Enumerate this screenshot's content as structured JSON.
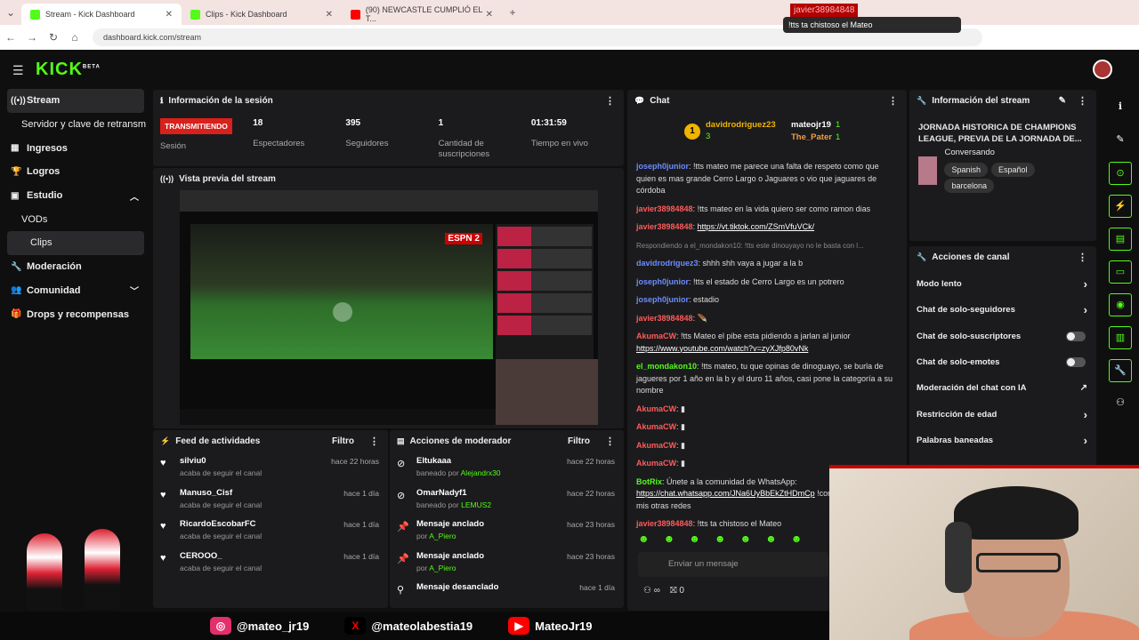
{
  "browser": {
    "tabs": [
      {
        "label": "Stream - Kick Dashboard",
        "active": true
      },
      {
        "label": "Clips - Kick Dashboard"
      },
      {
        "label": "(90) NEWCASTLE CUMPLIÓ EL T..."
      }
    ],
    "url": "dashboard.kick.com/stream"
  },
  "tooltip": {
    "user": "javier38984848",
    "text": "!tts ta chistoso el Mateo"
  },
  "header": {
    "logo": "KICK",
    "logo_sup": "BETA"
  },
  "sidebar": {
    "items": [
      {
        "label": "Stream"
      },
      {
        "label": "Servidor y clave de retransm"
      },
      {
        "label": "Ingresos"
      },
      {
        "label": "Logros"
      },
      {
        "label": "Estudio"
      },
      {
        "label": "VODs"
      },
      {
        "label": "Clips"
      },
      {
        "label": "Moderación"
      },
      {
        "label": "Comunidad"
      },
      {
        "label": "Drops y recompensas"
      }
    ]
  },
  "session": {
    "title": "Información de la sesión",
    "badge": "TRANSMITIENDO",
    "badge_label": "Sesión",
    "stats": [
      {
        "value": "18",
        "label": "Espectadores"
      },
      {
        "value": "395",
        "label": "Seguidores"
      },
      {
        "value": "1",
        "label": "Cantidad de suscripciones"
      },
      {
        "value": "01:31:59",
        "label": "Tiempo en vivo"
      }
    ]
  },
  "preview": {
    "title": "Vista previa del stream",
    "score": "ESPN 2"
  },
  "feed": {
    "title": "Feed de actividades",
    "filter": "Filtro",
    "items": [
      {
        "name": "silviu0",
        "sub": "acaba de seguir el canal",
        "time": "hace 22 horas"
      },
      {
        "name": "Manuso_Cisf",
        "sub": "acaba de seguir el canal",
        "time": "hace 1 día"
      },
      {
        "name": "RicardoEscobarFC",
        "sub": "acaba de seguir el canal",
        "time": "hace 1 día"
      },
      {
        "name": "CEROOO_",
        "sub": "acaba de seguir el canal",
        "time": "hace 1 día"
      }
    ]
  },
  "modactions": {
    "title": "Acciones de moderador",
    "filter": "Filtro",
    "items": [
      {
        "name": "Eltukaaa",
        "pre": "baneado por ",
        "by": "Alejandrx30",
        "time": "hace 22 horas"
      },
      {
        "name": "OmarNadyf1",
        "pre": "baneado por ",
        "by": "LEMUS2",
        "time": "hace 22 horas"
      },
      {
        "name": "Mensaje anclado",
        "pre": "por ",
        "by": "A_Piero",
        "time": "hace 23 horas"
      },
      {
        "name": "Mensaje anclado",
        "pre": "por ",
        "by": "A_Piero",
        "time": "hace 23 horas"
      },
      {
        "name": "Mensaje desanclado",
        "pre": "",
        "by": "",
        "time": "hace 1 día"
      }
    ]
  },
  "chat": {
    "title": "Chat",
    "top": [
      {
        "name": "davidrodriguez23",
        "count": "3"
      },
      {
        "name": "mateojr19",
        "count": "1"
      },
      {
        "name": "The_Pater",
        "count": "1"
      }
    ],
    "messages": [
      {
        "user": "joseph0junior",
        "cls": "u1",
        "text": ": !tts mateo me parece una falta de respeto como que quien es mas grande Cerro Largo o Jaguares o vio que jaguares de córdoba"
      },
      {
        "user": "javier38984848",
        "cls": "u2",
        "text": ": !tts mateo en la vida quiero ser como ramon dias"
      },
      {
        "user": "javier38984848",
        "cls": "u2",
        "text": ": ",
        "link": "https://vt.tiktok.com/ZSmVfuVCk/"
      },
      {
        "reply": "Respondiendo a el_mondakon10: !tts este dinouyayo no le basta con l..."
      },
      {
        "user": "davidrodriguez3",
        "cls": "u1",
        "text": ": shhh shh vaya a jugar a la b"
      },
      {
        "user": "joseph0junior",
        "cls": "u1",
        "text": ": !tts el estado de Cerro Largo es un potrero"
      },
      {
        "user": "joseph0junior",
        "cls": "u1",
        "text": ": estadio"
      },
      {
        "user": "javier38984848",
        "cls": "u2",
        "text": ": 🪶"
      },
      {
        "user": "AkumaCW",
        "cls": "u2",
        "text": ": !tts Mateo el pibe esta pidiendo a jarlan al junior ",
        "link": "https://www.youtube.com/watch?v=zyXJfp80vNk"
      },
      {
        "user": "el_mondakon10",
        "cls": "u3",
        "text": ": !tts mateo, tu que opinas de dinoguayo, se burla de jagueres por 1 año en la b y el duro 11 años, casi pone la categoría a su nombre"
      },
      {
        "user": "AkumaCW",
        "cls": "u2",
        "text": ": ▮"
      },
      {
        "user": "AkumaCW",
        "cls": "u2",
        "text": ": ▮"
      },
      {
        "user": "AkumaCW",
        "cls": "u2",
        "text": ": ▮"
      },
      {
        "user": "AkumaCW",
        "cls": "u2",
        "text": ": ▮"
      },
      {
        "user": "BotRix",
        "cls": "u3",
        "text": ": Únete a la comunidad de WhatsApp: ",
        "link": "https://chat.whatsapp.com/JNa6UyBbEkZtHDmCp",
        "after": " !comandos para ver mis otras redes"
      },
      {
        "user": "javier38984848",
        "cls": "u2",
        "text": ": !tts ta chistoso el Mateo"
      }
    ],
    "input_placeholder": "Enviar un mensaje",
    "points": "0"
  },
  "streaminfo": {
    "title": "Información del stream",
    "stream_title": "JORNADA HISTORICA DE CHAMPIONS LEAGUE, PREVIA DE LA JORNADA DE...",
    "category": "Conversando",
    "tags": [
      "Spanish",
      "Español",
      "barcelona"
    ]
  },
  "channel_actions": {
    "title": "Acciones de canal",
    "items": [
      {
        "label": "Modo lento",
        "kind": "chev"
      },
      {
        "label": "Chat de solo-seguidores",
        "kind": "chev"
      },
      {
        "label": "Chat de solo-suscriptores",
        "kind": "toggle"
      },
      {
        "label": "Chat de solo-emotes",
        "kind": "toggle"
      },
      {
        "label": "Moderación del chat con IA",
        "kind": "ext"
      },
      {
        "label": "Restricción de edad",
        "kind": "chev"
      },
      {
        "label": "Palabras baneadas",
        "kind": "chev"
      }
    ]
  },
  "social": [
    {
      "handle": "@mateo_jr19",
      "color": "#e1306c",
      "glyph": "◎"
    },
    {
      "handle": "@mateolabestia19",
      "color": "#000000",
      "glyph": "X"
    },
    {
      "handle": "MateoJr19",
      "color": "#ff0000",
      "glyph": "▶"
    }
  ]
}
